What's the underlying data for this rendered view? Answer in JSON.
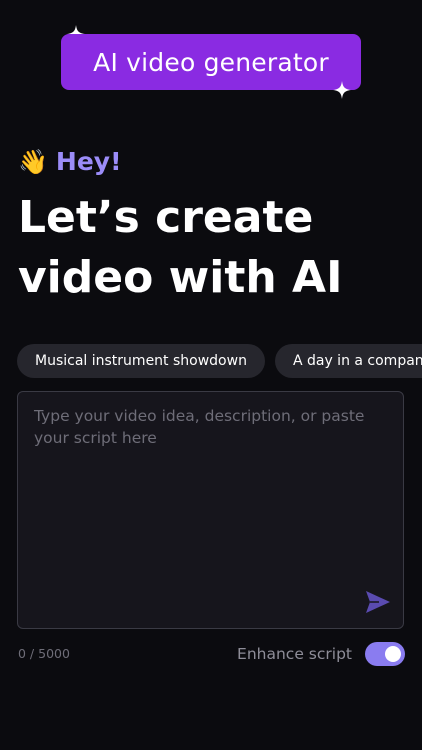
{
  "badge": {
    "label": "AI video generator",
    "color": "#8a2be2"
  },
  "greeting": {
    "emoji": "👋",
    "text": "Hey!",
    "color": "#9b8cf8"
  },
  "headline": {
    "line1": "Let’s create",
    "line2": "video with AI"
  },
  "suggestions": [
    {
      "label": "Musical instrument showdown"
    },
    {
      "label": "A day in a company"
    }
  ],
  "prompt": {
    "value": "",
    "placeholder": "Type your video idea, description, or paste your script here"
  },
  "counter": "0 / 5000",
  "enhance": {
    "label": "Enhance script",
    "enabled": true,
    "color": "#8a7cf0"
  },
  "icons": {
    "send": "send-icon",
    "sparkle": "sparkle-icon",
    "wave": "waving-hand-icon"
  }
}
